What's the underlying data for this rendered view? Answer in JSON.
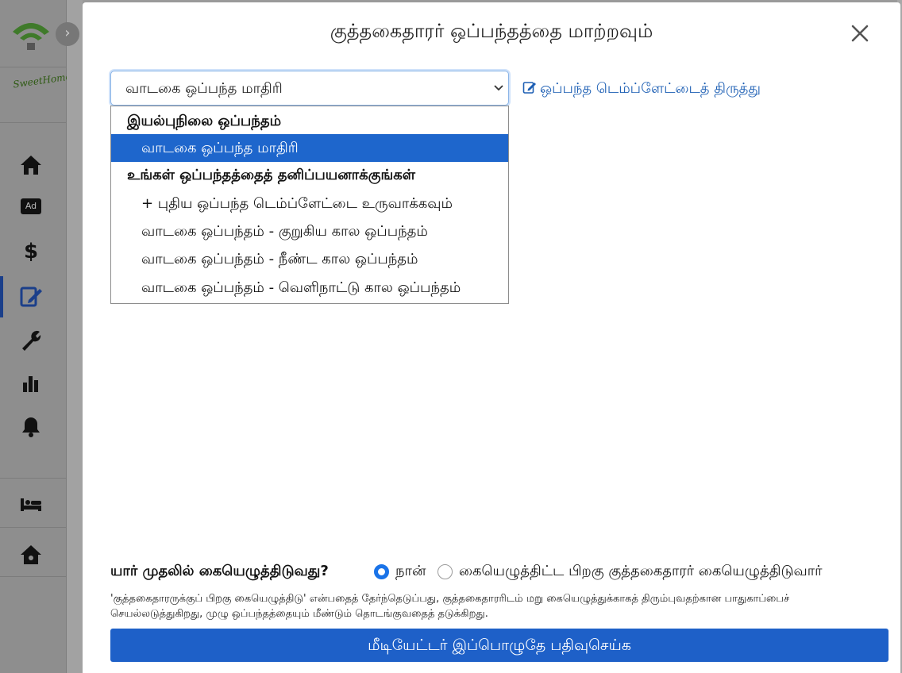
{
  "sidebar": {
    "brand_text": "SweetHome",
    "collapse_arrow": "›",
    "ad_badge": "Ad",
    "icons": [
      "home-icon",
      "ad-icon",
      "dollar-icon",
      "edit-contract-icon",
      "wrench-icon",
      "bar-chart-icon",
      "bell-icon",
      "bed-icon",
      "house-settings-icon"
    ],
    "active_item": "edit-contract-icon",
    "dollar_glyph": "$"
  },
  "modal": {
    "title": "குத்தகைதாரர் ஒப்பந்தத்தை மாற்றவும்",
    "close_icon": "close-icon",
    "select": {
      "selected_value": "வாடகை ஒப்பந்த மாதிரி"
    },
    "edit_template_link": "ஒப்பந்த டெம்ப்ளேட்டைத் திருத்து",
    "dropdown": {
      "group_default": "இயல்புநிலை ஒப்பந்தம்",
      "default_option": "வாடகை ஒப்பந்த மாதிரி",
      "group_custom": "உங்கள் ஒப்பந்தத்தைத் தனிப்பயனாக்குங்கள்",
      "custom_options": [
        "+ புதிய ஒப்பந்த டெம்ப்ளேட்டை உருவாக்கவும்",
        "வாடகை ஒப்பந்தம் - குறுகிய கால ஒப்பந்தம்",
        "வாடகை ஒப்பந்தம் - நீண்ட கால ஒப்பந்தம்",
        "வாடகை ஒப்பந்தம் - வெளிநாட்டு கால ஒப்பந்தம்"
      ]
    },
    "who_signs_first": {
      "question": "யார் முதலில் கையெழுத்திடுவது?",
      "option_me": "நான்",
      "option_tenant_after": "கையெழுத்திட்ட பிறகு குத்தகைதாரர் கையெழுத்திடுவார்",
      "selected": "option_me"
    },
    "note": "'குத்தகைதாரருக்குப் பிறகு கையெழுத்திடு' என்பதைத் தேர்ந்தெடுப்பது, குத்தகைதாரரிடம் மறு கையெழுத்துக்காகத் திரும்புவதற்கான பாதுகாப்பைச் செயல்லடுத்துகிறது, முழு ஒப்பந்தத்தையும் மீண்டும் தொடங்குவதைத் தடுக்கிறது.",
    "register_button": "மீடியேட்டர் இப்பொழுதே பதிவுசெய்க"
  },
  "colors": {
    "primary": "#1e60c8",
    "link": "#1d5fb4",
    "selected_option": "#1e66cc",
    "overlay": "#9a9a9a"
  }
}
